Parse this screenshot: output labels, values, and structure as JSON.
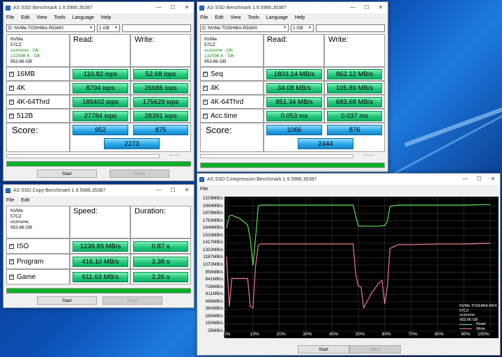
{
  "bench1": {
    "title": "AS SSD Benchmark 1.9.5986.35387",
    "menu": [
      "File",
      "Edit",
      "View",
      "Tools",
      "Language",
      "Help"
    ],
    "drive": "D: NVMe TOSHIBA-RD400",
    "size": "1 GB",
    "info": [
      "NVMe",
      "57CZ",
      "ocznvme - OK",
      "132096 K - OK",
      "953.86 GB"
    ],
    "read_header": "Read:",
    "write_header": "Write:",
    "rows": [
      {
        "label": "16MB",
        "read": "110.82 iops",
        "write": "52.68 iops"
      },
      {
        "label": "4K",
        "read": "8794 iops",
        "write": "26686 iops"
      },
      {
        "label": "4K-64Thrd",
        "read": "189402 iops",
        "write": "175629 iops"
      },
      {
        "label": "512B",
        "read": "27784 iops",
        "write": "28391 iops"
      }
    ],
    "score_label": "Score:",
    "score_read": "952",
    "score_write": "875",
    "score_total": "2273",
    "dashes": "--:--:--",
    "start": "Start",
    "abort": "Abort"
  },
  "bench2": {
    "title": "AS SSD Benchmark 1.9.5986.35387",
    "menu": [
      "File",
      "Edit",
      "View",
      "Tools",
      "Language",
      "Help"
    ],
    "drive": "D: NVMe TOSHIBA-RD400",
    "size": "1 GB",
    "info": [
      "NVMe",
      "57CZ",
      "ocznvme - OK",
      "132096 K - OK",
      "953.86 GB"
    ],
    "read_header": "Read:",
    "write_header": "Write:",
    "rows": [
      {
        "label": "Seq",
        "read": "1803.14 MB/s",
        "write": "862.12 MB/s"
      },
      {
        "label": "4K",
        "read": "34.08 MB/s",
        "write": "105.89 MB/s"
      },
      {
        "label": "4K-64Thrd",
        "read": "851.34 MB/s",
        "write": "683.68 MB/s"
      },
      {
        "label": "Acc.time",
        "read": "0.053 ms",
        "write": "0.037 ms"
      }
    ],
    "score_label": "Score:",
    "score_read": "1066",
    "score_write": "876",
    "score_total": "2444",
    "dashes": "--:--:--"
  },
  "copy": {
    "title": "AS SSD Copy-Benchmark 1.9.5986.35387",
    "menu": [
      "File",
      "Edit"
    ],
    "info": [
      "NVMe",
      "57CZ",
      "ocznvme",
      "953.86 GB"
    ],
    "speed_header": "Speed:",
    "duration_header": "Duration:",
    "rows": [
      {
        "label": "ISO",
        "speed": "1239.89 MB/s",
        "duration": "0.87 s"
      },
      {
        "label": "Program",
        "speed": "416.10 MB/s",
        "duration": "3.38 s"
      },
      {
        "label": "Game",
        "speed": "611.63 MB/s",
        "duration": "2.26 s"
      }
    ],
    "start": "Start",
    "abort": "Abort"
  },
  "compression": {
    "title": "AS SSD Compression-Benchmark 1.9.5986.35387",
    "menu": [
      "File"
    ],
    "legend": [
      "NVMe TOSHIBA-RD4",
      "57CZ",
      "ocznvme",
      "953.86 GB"
    ],
    "series_names": [
      "Read",
      "Write"
    ],
    "start": "Start",
    "abort": "Abort"
  },
  "chart_data": {
    "type": "line",
    "title": "",
    "xlabel": "",
    "ylabel": "",
    "y_ticks": [
      "2109MB/s",
      "1994MB/s",
      "1878MB/s",
      "1763MB/s",
      "1648MB/s",
      "1533MB/s",
      "1417MB/s",
      "1302MB/s",
      "1187MB/s",
      "1072MB/s",
      "956MB/s",
      "841MB/s",
      "726MB/s",
      "611MB/s",
      "496MB/s",
      "380MB/s",
      "265MB/s",
      "150MB/s",
      "35MB/s"
    ],
    "x_ticks": [
      "0%",
      "10%",
      "20%",
      "30%",
      "40%",
      "50%",
      "60%",
      "70%",
      "80%",
      "90%",
      "100%"
    ],
    "ylim": [
      35,
      2109
    ],
    "xlim": [
      0,
      100
    ],
    "legend_position": "bottom-right",
    "colors": {
      "read": "#5fdc5f",
      "write": "#e87a8a"
    },
    "series": [
      {
        "name": "Read",
        "x": [
          0,
          1,
          2,
          5,
          8,
          9,
          10,
          11,
          12,
          13,
          20,
          30,
          40,
          48,
          49,
          50,
          55,
          58,
          60,
          61,
          62,
          65,
          70,
          80,
          90,
          100
        ],
        "y": [
          1650,
          1840,
          1850,
          1800,
          1700,
          1480,
          1060,
          1500,
          1990,
          2010,
          2010,
          2010,
          2010,
          2010,
          1840,
          1680,
          1680,
          1680,
          1690,
          1760,
          1990,
          2010,
          2010,
          2010,
          2010,
          2020
        ]
      },
      {
        "name": "Write",
        "x": [
          0,
          1,
          2,
          5,
          8,
          9,
          10,
          11,
          12,
          13,
          20,
          30,
          40,
          48,
          49,
          50,
          51,
          52,
          55,
          58,
          59,
          60,
          61,
          62,
          65,
          70,
          80,
          90,
          100
        ],
        "y": [
          1200,
          420,
          860,
          860,
          860,
          420,
          400,
          1060,
          1380,
          1400,
          1400,
          1400,
          1400,
          1400,
          930,
          740,
          730,
          400,
          630,
          800,
          830,
          460,
          740,
          1330,
          1390,
          1390,
          1400,
          1400,
          1410
        ]
      }
    ]
  }
}
